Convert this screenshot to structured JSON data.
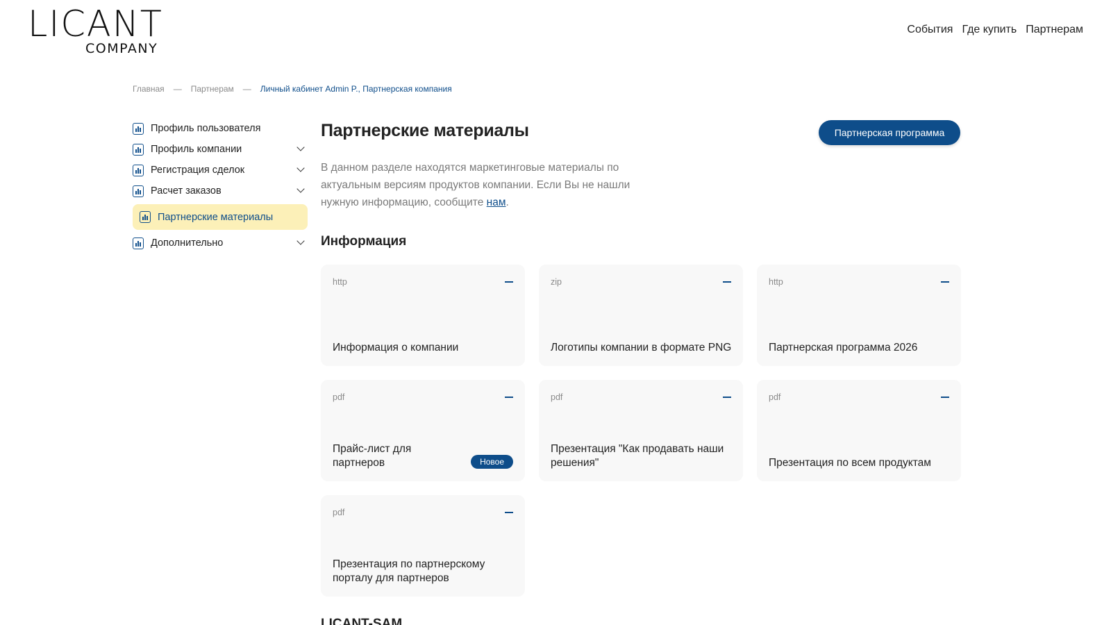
{
  "brand": {
    "name": "LICANT",
    "sub": "COMPANY"
  },
  "topnav": [
    "События",
    "Где купить",
    "Партнерам"
  ],
  "breadcrumb": {
    "home": "Главная",
    "sep": "—",
    "partners": "Партнерам",
    "current": "Личный кабинет Admin P., Партнерская компания"
  },
  "sidebar": {
    "items": [
      {
        "label": "Профиль пользователя"
      },
      {
        "label": "Профиль компании"
      },
      {
        "label": "Регистрация сделок"
      },
      {
        "label": "Расчет заказов"
      },
      {
        "label": "Партнерские материалы"
      },
      {
        "label": "Дополнительно"
      }
    ]
  },
  "main": {
    "title": "Партнерские материалы",
    "cta": "Партнерская программа",
    "intro": "В данном разделе находятся маркетинговые материалы по актуальным версиям продуктов компании. Если Вы не нашли нужную информацию, сообщите ",
    "intro_link": "нам",
    "intro_end": ".",
    "section1": "Информация",
    "section2": "LICANT-SAM",
    "cards": [
      {
        "type": "http",
        "title": "Информация о компании"
      },
      {
        "type": "zip",
        "title": "Логотипы компании в формате PNG"
      },
      {
        "type": "http",
        "title": "Партнерская программа 2026"
      },
      {
        "type": "pdf",
        "title": "Прайс-лист для партнеров",
        "badge": "Новое"
      },
      {
        "type": "pdf",
        "title": "Презентация \"Как продавать наши решения\""
      },
      {
        "type": "pdf",
        "title": "Презентация по всем продуктам"
      },
      {
        "type": "pdf",
        "title": "Презентация по партнерскому порталу для партнеров"
      }
    ]
  },
  "colors": {
    "accent": "#0e4d8a",
    "active_bg": "#fcf0b8",
    "card_bg": "#f8f8f8"
  }
}
